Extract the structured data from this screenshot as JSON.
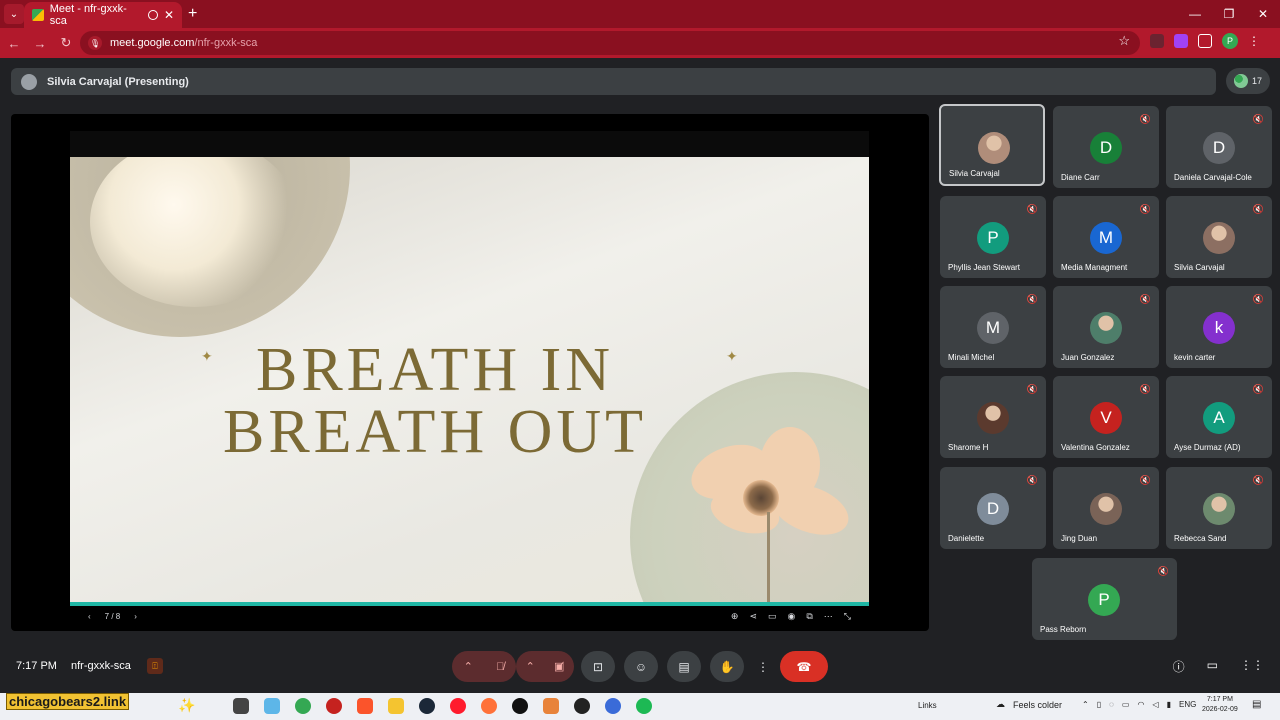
{
  "browser": {
    "tab_title": "Meet - nfr-gxxk-sca",
    "url_host": "meet.google.com",
    "url_path": "/nfr-gxxk-sca",
    "profile_initial": "P",
    "accent_color": "#b2192c"
  },
  "meet": {
    "presenter_label": "Silvia Carvajal (Presenting)",
    "participant_count": "17",
    "slide": {
      "line1": "BREATH IN",
      "line2": "BREATH OUT",
      "pager": "7 / 8"
    },
    "participants": [
      {
        "name": "Silvia Carvajal",
        "initial": "",
        "color": "",
        "photo": true
      },
      {
        "name": "Diane Carr",
        "initial": "D",
        "color": "#188038"
      },
      {
        "name": "Daniela Carvajal-Cole",
        "initial": "D",
        "color": "#5f6368"
      },
      {
        "name": "Phyllis Jean Stewart",
        "initial": "P",
        "color": "#129c7e"
      },
      {
        "name": "Media Managment",
        "initial": "M",
        "color": "#1967d2"
      },
      {
        "name": "Silvia Carvajal",
        "initial": "",
        "color": "",
        "photo": true
      },
      {
        "name": "Minali Michel",
        "initial": "M",
        "color": "#5f6368"
      },
      {
        "name": "Juan Gonzalez",
        "initial": "",
        "color": "",
        "photo": true
      },
      {
        "name": "kevin carter",
        "initial": "k",
        "color": "#8430ce"
      },
      {
        "name": "Sharome H",
        "initial": "",
        "color": "",
        "photo": true
      },
      {
        "name": "Valentina Gonzalez",
        "initial": "V",
        "color": "#c5221f"
      },
      {
        "name": "Ayse Durmaz (AD)",
        "initial": "A",
        "color": "#129c7e"
      },
      {
        "name": "Danielette",
        "initial": "D",
        "color": "#7f8c9a"
      },
      {
        "name": "Jing Duan",
        "initial": "",
        "color": "",
        "photo": true
      },
      {
        "name": "Rebecca Sand",
        "initial": "",
        "color": "",
        "photo": true
      },
      {
        "name": "Pass Reborn",
        "initial": "P",
        "color": "#34a853"
      }
    ],
    "time": "7:17 PM",
    "meeting_code": "nfr-gxxk-sca"
  },
  "taskbar": {
    "brand_text": "chicagobears2.link",
    "links_label": "Links",
    "weather": "Feels colder",
    "lang": "ENG",
    "time": "7:17 PM",
    "date": "2026-02-09"
  }
}
